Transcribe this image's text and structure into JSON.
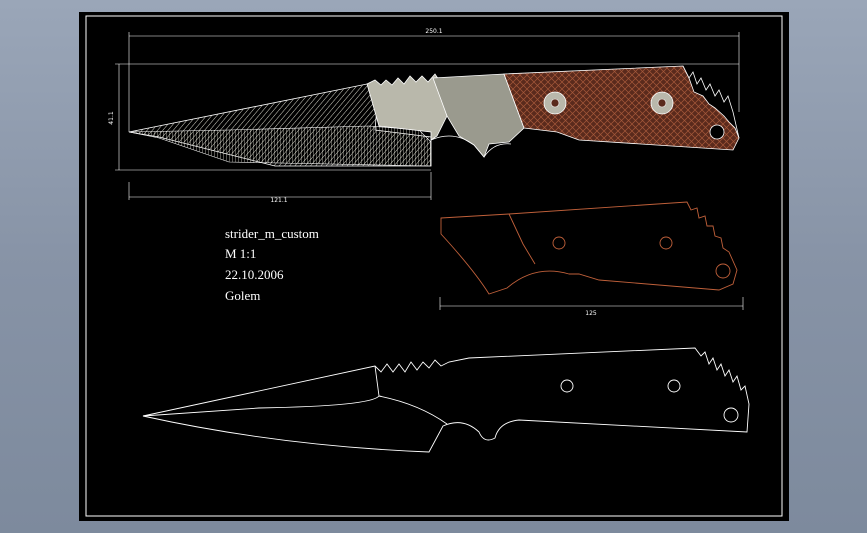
{
  "title_block": {
    "name": "strider_m_custom",
    "scale": "M 1:1",
    "date": "22.10.2006",
    "author": "Golem"
  },
  "dimensions": {
    "overall_length": "250.1",
    "blade_length": "121.1",
    "height": "41.1",
    "handle_length": "125"
  },
  "colors": {
    "sheet": "#000000",
    "lines": "#ffffff",
    "blade_fill": "#b9b8ab",
    "guard_fill": "#9a9a8e",
    "handle_fill": "#5a2a1c",
    "handle_hatch": "#a4583a",
    "scale_outline": "#c0603a"
  }
}
